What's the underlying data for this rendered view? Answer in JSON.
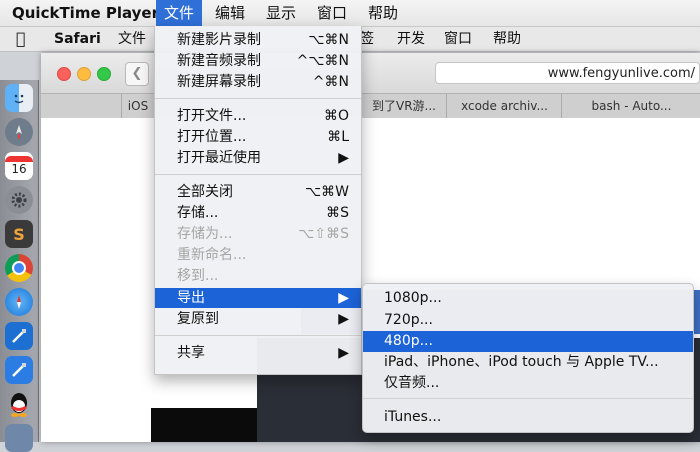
{
  "menubar": {
    "app": "QuickTime Player",
    "items": [
      "文件",
      "编辑",
      "显示",
      "窗口",
      "帮助"
    ]
  },
  "background": {
    "menubar": {
      "apple_icon": "apple-icon",
      "app": "Safari",
      "items": [
        "文件",
        "签",
        "开发",
        "窗口",
        "帮助"
      ]
    },
    "browser": {
      "address": "www.fengyunlive.com/",
      "tabs": [
        "iOS",
        "到了VR游...",
        "xcode archiv...",
        "bash - Auto..."
      ]
    },
    "dock_icons": [
      "finder-icon",
      "launchpad-icon",
      "calendar-icon",
      "system-preferences-icon",
      "sublime-icon",
      "chrome-icon",
      "safari-icon",
      "xcode-icon",
      "xcode-icon",
      "qq-icon",
      "app-icon"
    ],
    "calendar_day": "16"
  },
  "file_menu": {
    "items": [
      {
        "label": "新建影片录制",
        "shortcut": "⌥⌘N"
      },
      {
        "label": "新建音频录制",
        "shortcut": "^⌥⌘N"
      },
      {
        "label": "新建屏幕录制",
        "shortcut": "^⌘N"
      },
      {
        "label": "打开文件...",
        "shortcut": "⌘O"
      },
      {
        "label": "打开位置...",
        "shortcut": "⌘L"
      },
      {
        "label": "打开最近使用",
        "shortcut": "▶"
      },
      {
        "label": "全部关闭",
        "shortcut": "⌥⌘W"
      },
      {
        "label": "存储...",
        "shortcut": "⌘S"
      },
      {
        "label": "存储为...",
        "shortcut": "⌥⇧⌘S"
      },
      {
        "label": "重新命名...",
        "shortcut": ""
      },
      {
        "label": "移到...",
        "shortcut": ""
      },
      {
        "label": "导出",
        "shortcut": "▶"
      },
      {
        "label": "复原到",
        "shortcut": "▶"
      },
      {
        "label": "共享",
        "shortcut": "▶"
      }
    ]
  },
  "export_submenu": {
    "items": [
      "1080p...",
      "720p...",
      "480p...",
      "iPad、iPhone、iPod touch 与 Apple TV...",
      "仅音频...",
      "iTunes..."
    ]
  },
  "colors": {
    "selection": "#1c63d8",
    "disabled_text": "#a6a6a6"
  }
}
